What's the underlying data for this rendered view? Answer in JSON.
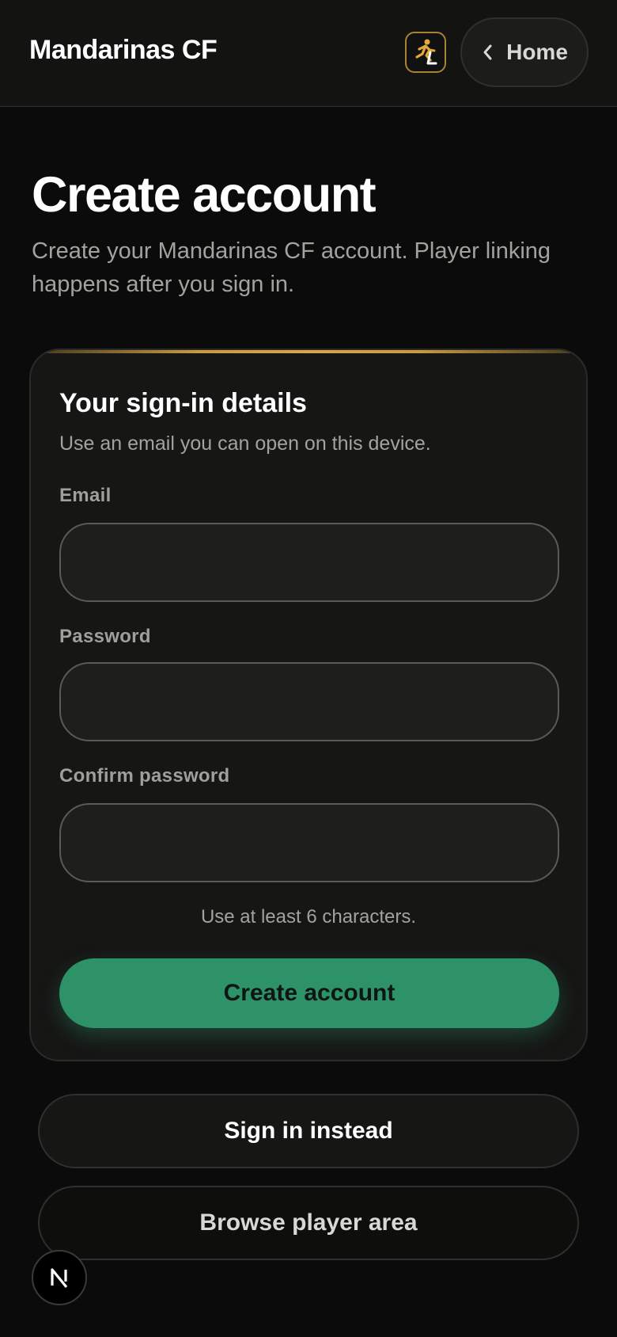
{
  "header": {
    "brand": "Mandarinas CF",
    "home_label": "Home"
  },
  "page": {
    "title": "Create account",
    "subtitle": "Create your Mandarinas CF account. Player linking happens after you sign in."
  },
  "form": {
    "title": "Your sign-in details",
    "subtitle": "Use an email you can open on this device.",
    "email_label": "Email",
    "email_value": "",
    "password_label": "Password",
    "password_value": "",
    "confirm_label": "Confirm password",
    "confirm_value": "",
    "hint": "Use at least 6 characters.",
    "submit_label": "Create account"
  },
  "actions": {
    "sign_in_label": "Sign in instead",
    "browse_label": "Browse player area"
  },
  "colors": {
    "accent_green": "#2e9268",
    "accent_gold": "#c79a43",
    "background": "#0b0b0b"
  }
}
